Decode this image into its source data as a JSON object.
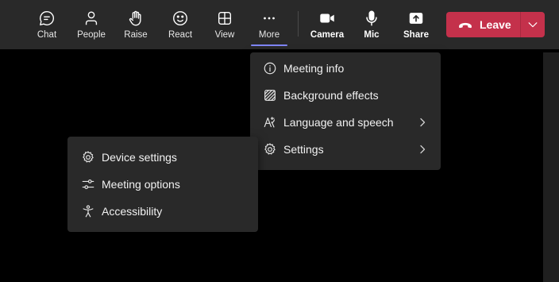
{
  "toolbar": {
    "buttons": [
      {
        "label": "Chat",
        "icon": "chat-icon"
      },
      {
        "label": "People",
        "icon": "people-icon"
      },
      {
        "label": "Raise",
        "icon": "raise-hand-icon"
      },
      {
        "label": "React",
        "icon": "smiley-icon"
      },
      {
        "label": "View",
        "icon": "grid-view-icon"
      },
      {
        "label": "More",
        "icon": "more-ellipsis-icon",
        "active": true
      },
      {
        "label": "Camera",
        "icon": "camera-icon"
      },
      {
        "label": "Mic",
        "icon": "microphone-icon"
      },
      {
        "label": "Share",
        "icon": "share-tray-icon"
      }
    ],
    "leave_label": "Leave",
    "accent": "#7f85f5",
    "leave_color": "#c4314b"
  },
  "more_menu": {
    "items": [
      {
        "label": "Meeting info",
        "icon": "info-icon",
        "has_submenu": false
      },
      {
        "label": "Background effects",
        "icon": "background-effects-icon",
        "has_submenu": false
      },
      {
        "label": "Language and speech",
        "icon": "language-icon",
        "has_submenu": true
      },
      {
        "label": "Settings",
        "icon": "gear-icon",
        "has_submenu": true
      }
    ]
  },
  "settings_menu": {
    "items": [
      {
        "label": "Device settings",
        "icon": "gear-icon"
      },
      {
        "label": "Meeting options",
        "icon": "sliders-icon"
      },
      {
        "label": "Accessibility",
        "icon": "accessibility-icon"
      }
    ]
  }
}
